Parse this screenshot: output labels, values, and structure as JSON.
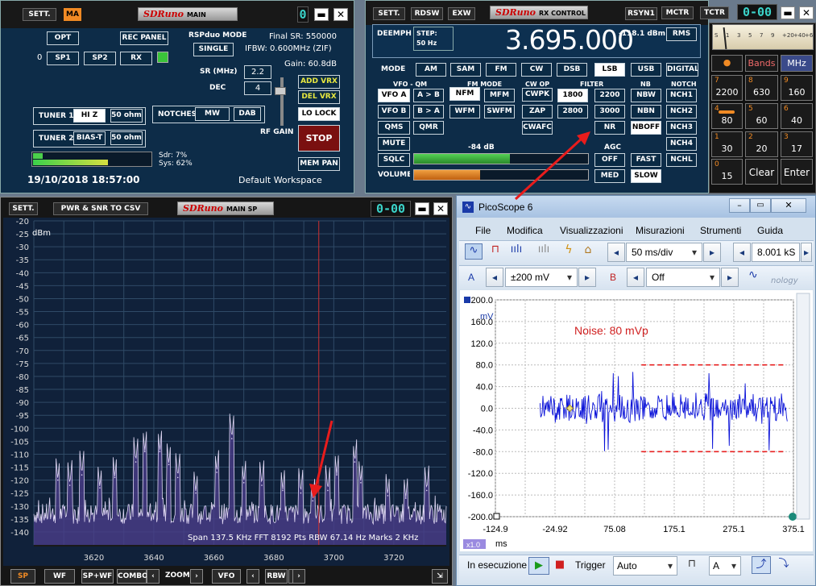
{
  "main": {
    "sett": "SETT.",
    "ma": "MA",
    "logo_brand": "SDRuno",
    "logo_title": "MAIN",
    "counter": "0",
    "opt": "OPT",
    "rec_panel": "REC PANEL",
    "mode_title": "RSPduo MODE",
    "mode_value": "SINGLE",
    "final_sr": "Final SR: 550000",
    "ifbw": "IFBW: 0.600MHz (ZIF)",
    "gain": "Gain: 60.8dB",
    "zero": "0",
    "sp1": "SP1",
    "sp2": "SP2",
    "rx": "RX",
    "sr_label": "SR (MHz)",
    "sr_value": "2.2",
    "dec_label": "DEC",
    "dec_value": "4",
    "add_vrx": "ADD VRX",
    "del_vrx": "DEL VRX",
    "lo_lock": "LO LOCK",
    "stop": "STOP",
    "mem_pan": "MEM PAN",
    "rf_gain": "RF GAIN",
    "tuner1": "TUNER 1",
    "tuner1_opt": "HI Z",
    "tuner1_ohm": "50 ohm",
    "notches": "NOTCHES",
    "mw": "MW",
    "dab": "DAB",
    "tuner2": "TUNER 2",
    "tuner2_opt": "BIAS-T",
    "tuner2_ohm": "50 ohm",
    "sdr": "Sdr: 7%",
    "sys": "Sys: 62%",
    "datetime": "19/10/2018 18:57:00",
    "workspace": "Default Workspace"
  },
  "rx": {
    "sett": "SETT.",
    "rdsw": "RDSW",
    "exw": "EXW",
    "logo_brand": "SDRuno",
    "logo_title": "RX CONTROL",
    "rsyn": "RSYN1",
    "mctr": "MCTR",
    "tctr": "TCTR",
    "counter": "0-00",
    "deemph": "DEEMPH",
    "step_label": "STEP:",
    "step_value": "50 Hz",
    "frequency": "3.695.000",
    "dbm": "-118.1 dBm",
    "rms": "RMS",
    "mode_label": "MODE",
    "modes": [
      "AM",
      "SAM",
      "FM",
      "CW",
      "DSB",
      "LSB",
      "USB",
      "DIGITAL"
    ],
    "vfo_qm": "VFO - QM",
    "fm_mode": "FM MODE",
    "cw_op": "CW OP",
    "filter": "FILTER",
    "nb": "NB",
    "notch": "NOTCH",
    "vfo_a": "VFO A",
    "a_to_b": "A > B",
    "nfm": "NFM",
    "mfm": "MFM",
    "cwpk": "CWPK",
    "f1800": "1800",
    "f2200": "2200",
    "nbw": "NBW",
    "nch1": "NCH1",
    "vfo_b": "VFO B",
    "b_to_a": "B > A",
    "wfm": "WFM",
    "swfm": "SWFM",
    "zap": "ZAP",
    "f2800": "2800",
    "f3000": "3000",
    "nbn": "NBN",
    "nch2": "NCH2",
    "qms": "QMS",
    "qmr": "QMR",
    "cwafc": "CWAFC",
    "nr": "NR",
    "nboff": "NBOFF",
    "nch3": "NCH3",
    "mute": "MUTE",
    "sq_db": "-84 dB",
    "agc": "AGC",
    "nch4": "NCH4",
    "sqlc": "SQLC",
    "agc_off": "OFF",
    "agc_fast": "FAST",
    "nchl": "NCHL",
    "volume": "VOLUME",
    "agc_med": "MED",
    "agc_slow": "SLOW",
    "volume_level": 0.38,
    "squelch_level": 0.55
  },
  "keypad": {
    "bands": "Bands",
    "mhz": "MHz",
    "keys": [
      {
        "n": "7",
        "v": "2200"
      },
      {
        "n": "8",
        "v": "630"
      },
      {
        "n": "9",
        "v": "160"
      },
      {
        "n": "4",
        "v": "80"
      },
      {
        "n": "5",
        "v": "60"
      },
      {
        "n": "6",
        "v": "40"
      },
      {
        "n": "1",
        "v": "30"
      },
      {
        "n": "2",
        "v": "20"
      },
      {
        "n": "3",
        "v": "17"
      },
      {
        "n": "0",
        "v": "15"
      }
    ],
    "clear": "Clear",
    "enter": "Enter",
    "meter_scale": [
      "S",
      "1",
      "3",
      "5",
      "7",
      "9",
      "+20",
      "+40",
      "+60"
    ]
  },
  "sp": {
    "sett": "SETT.",
    "csv": "PWR & SNR TO CSV",
    "logo_brand": "SDRuno",
    "logo_title": "MAIN SP",
    "counter": "0-00",
    "unit": "dBm",
    "status": "Span 137.5 KHz   FFT 8192 Pts   RBW 67.14 Hz   Marks 2 KHz",
    "bottom": {
      "sp": "SP",
      "wf": "WF",
      "spwf": "SP+WF",
      "combo": "COMBO",
      "zoom": "ZOOM",
      "vfo": "VFO",
      "rbw": "RBW"
    },
    "colors": {
      "bg": "#10213a",
      "trace": "#d8d0f0",
      "fill": "#5a4a9a",
      "grid": "#3b5670",
      "cursor": "#cc3333"
    }
  },
  "pico": {
    "title": "PicoScope 6",
    "menu": [
      "File",
      "Modifica",
      "Visualizzazioni",
      "Misurazioni",
      "Strumenti",
      "Guida"
    ],
    "timebase": "50 ms/div",
    "samples": "8.001 kS",
    "ch_a": "A",
    "range_a": "±200 mV",
    "ch_b": "B",
    "range_b": "Off",
    "brand_fragment": "nology",
    "y_unit": "mV",
    "x_unit": "ms",
    "zoom": "x1.0",
    "noise_label": "Noise: 80 mVp",
    "running": "In esecuzione",
    "trigger": "Trigger",
    "trigger_mode": "Auto",
    "trigger_ch": "A"
  },
  "chart_data": [
    {
      "type": "line",
      "title": "",
      "ylabel": "dBm",
      "xlabel": "",
      "xlim": [
        3600,
        3737.5
      ],
      "ylim": [
        -145,
        -20
      ],
      "yticks": [
        -20,
        -25,
        -30,
        -35,
        -40,
        -45,
        -50,
        -55,
        -60,
        -65,
        -70,
        -75,
        -80,
        -85,
        -90,
        -95,
        -100,
        -105,
        -110,
        -115,
        -120,
        -125,
        -130,
        -135,
        -140
      ],
      "xticks": [
        3620,
        3640,
        3660,
        3680,
        3700,
        3720
      ],
      "marker_x": 3695,
      "noise_floor": -133,
      "peaks": [
        {
          "x": 3608,
          "y": -120
        },
        {
          "x": 3612,
          "y": -122
        },
        {
          "x": 3616,
          "y": -118
        },
        {
          "x": 3622,
          "y": -123
        },
        {
          "x": 3627,
          "y": -119
        },
        {
          "x": 3634,
          "y": -113
        },
        {
          "x": 3637,
          "y": -109
        },
        {
          "x": 3642,
          "y": -109
        },
        {
          "x": 3645,
          "y": -114
        },
        {
          "x": 3648,
          "y": -119
        },
        {
          "x": 3654,
          "y": -125
        },
        {
          "x": 3661,
          "y": -117
        },
        {
          "x": 3666,
          "y": -104
        },
        {
          "x": 3670,
          "y": -121
        },
        {
          "x": 3676,
          "y": -122
        },
        {
          "x": 3683,
          "y": -124
        },
        {
          "x": 3689,
          "y": -125
        },
        {
          "x": 3693,
          "y": -128
        },
        {
          "x": 3698,
          "y": -124
        },
        {
          "x": 3701,
          "y": -118
        },
        {
          "x": 3707,
          "y": -113
        },
        {
          "x": 3709,
          "y": -121
        },
        {
          "x": 3718,
          "y": -126
        },
        {
          "x": 3724,
          "y": -127
        },
        {
          "x": 3731,
          "y": -124
        }
      ],
      "grid": true
    },
    {
      "type": "line",
      "title": "",
      "xlabel": "ms",
      "ylabel": "mV",
      "xlim": [
        -124.9,
        375.1
      ],
      "ylim": [
        -200,
        200
      ],
      "xticks": [
        -124.9,
        -24.92,
        75.08,
        175.1,
        275.1,
        375.1
      ],
      "yticks": [
        200,
        160,
        120,
        80,
        40,
        0,
        -40,
        -80,
        -120,
        -160,
        -200
      ],
      "series": [
        {
          "values_envelope": {
            "typical": 25,
            "peak": 80
          }
        }
      ],
      "noise_lines": [
        80,
        -80
      ],
      "annotation": "Noise: 80 mVp",
      "grid": true
    }
  ]
}
